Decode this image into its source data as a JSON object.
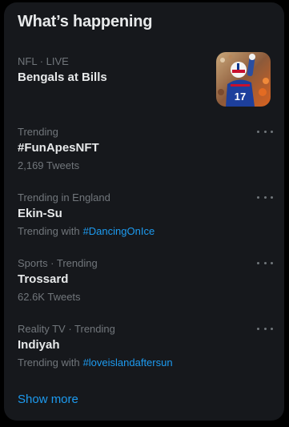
{
  "panel": {
    "title": "What’s happening",
    "show_more": "Show more"
  },
  "trends": [
    {
      "meta": "NFL · LIVE",
      "name": "Bengals at Bills",
      "has_image": true,
      "image_icon": "football-player-thumbnail"
    },
    {
      "meta": "Trending",
      "name": "#FunApesNFT",
      "sub": "2,169 Tweets"
    },
    {
      "meta": "Trending in England",
      "name": "Ekin-Su",
      "sub_prefix": "Trending with",
      "sub_tag": "#DancingOnIce"
    },
    {
      "meta": "Sports · Trending",
      "name": "Trossard",
      "sub": "62.6K Tweets"
    },
    {
      "meta": "Reality TV · Trending",
      "name": "Indiyah",
      "sub_prefix": "Trending with",
      "sub_tag": "#loveislandaftersun"
    }
  ],
  "colors": {
    "panel_bg": "#16181c",
    "primary_text": "#e7e9ea",
    "secondary_text": "#71767b",
    "accent": "#1d9bf0"
  }
}
